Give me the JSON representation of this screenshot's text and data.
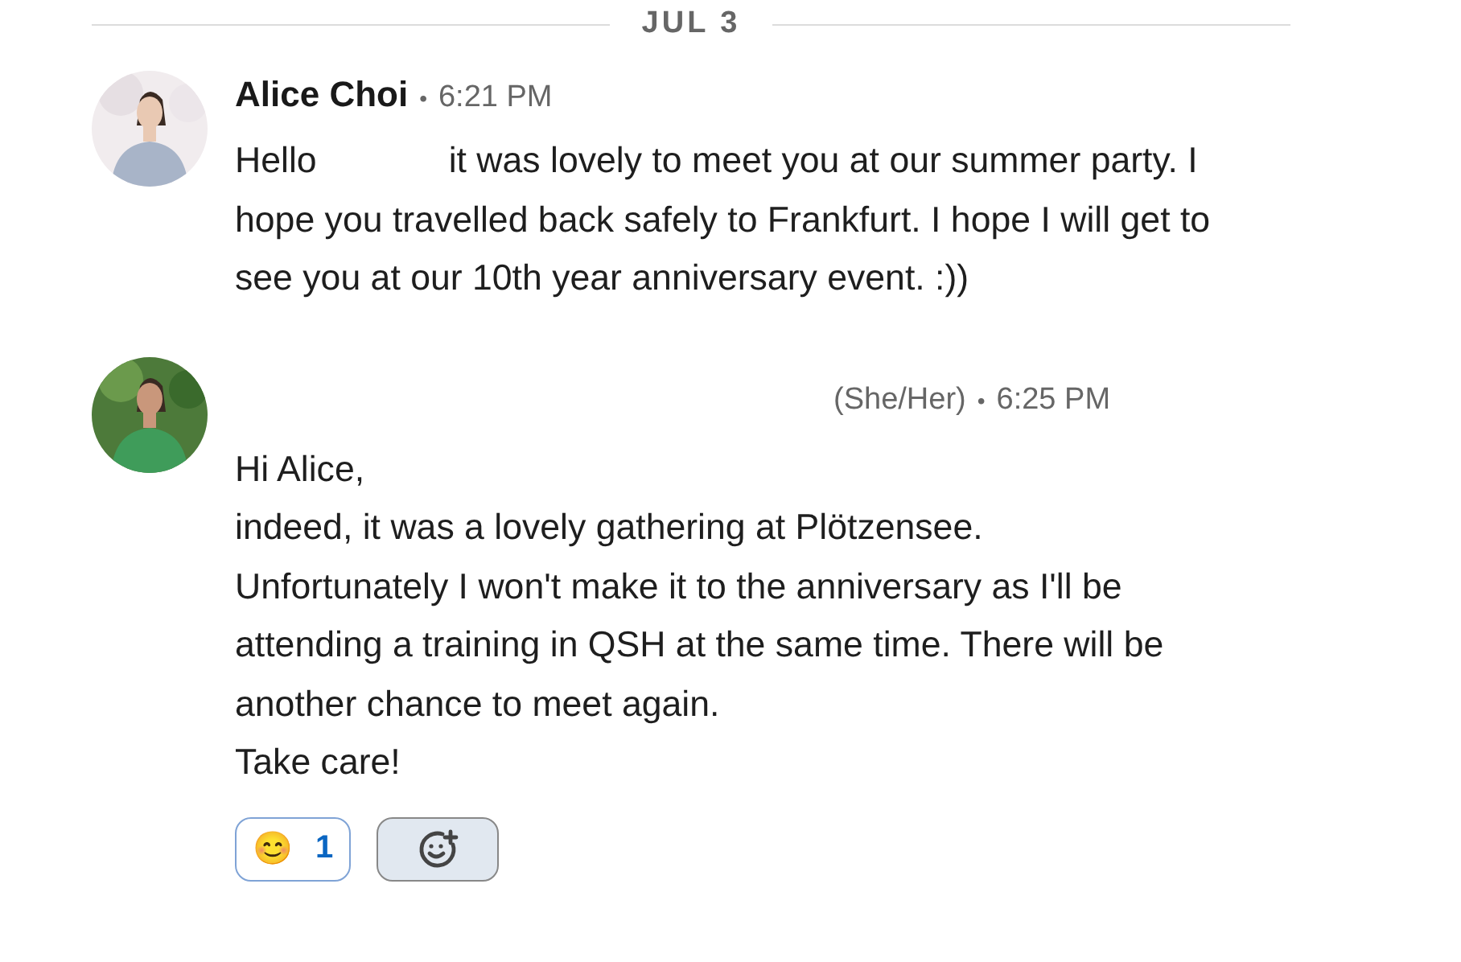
{
  "date_divider": "JUL 3",
  "messages": [
    {
      "sender": "Alice Choi",
      "separator": "•",
      "time": "6:21 PM",
      "greeting": "Hello",
      "paragraphs": [
        "it was lovely to meet you at our summer party. I hope you travelled back safely to Frankfurt. I hope I will get to see you at our 10th year anniversary event. :))"
      ]
    },
    {
      "pronouns": "(She/Her)",
      "separator": "•",
      "time": "6:25 PM",
      "paragraphs": [
        "Hi Alice,",
        "indeed, it was a lovely gathering at Plötzensee.",
        "Unfortunately I won't make it to the anniversary as I'll be attending a training in QSH at the same time. There will be another chance to meet again.",
        "Take care!"
      ],
      "reactions": [
        {
          "kind": "emoji",
          "emoji": "😊",
          "count": "1",
          "selected": true
        },
        {
          "kind": "add",
          "selected": false
        }
      ]
    }
  ]
}
